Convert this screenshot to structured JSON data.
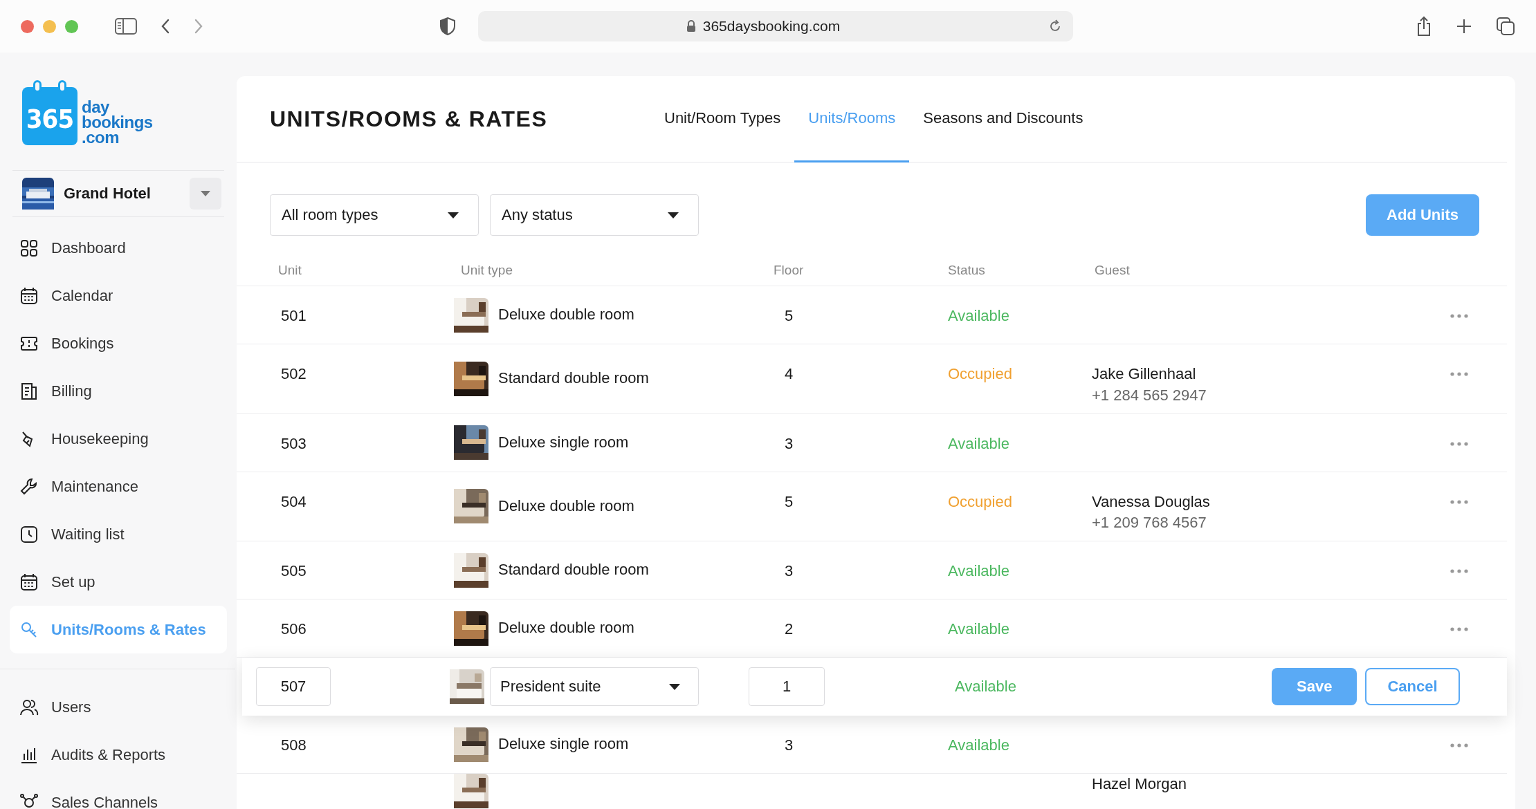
{
  "browser": {
    "url": "365daysbooking.com"
  },
  "logo": {
    "number": "365",
    "lines": [
      "day",
      "bookings",
      ".com"
    ]
  },
  "property": {
    "name": "Grand Hotel"
  },
  "sidebar": {
    "items": [
      {
        "label": "Dashboard",
        "selected": false
      },
      {
        "label": "Calendar",
        "selected": false
      },
      {
        "label": "Bookings",
        "selected": false
      },
      {
        "label": "Billing",
        "selected": false
      },
      {
        "label": "Housekeeping",
        "selected": false
      },
      {
        "label": "Maintenance",
        "selected": false
      },
      {
        "label": "Waiting list",
        "selected": false
      },
      {
        "label": "Set up",
        "selected": false
      },
      {
        "label": "Units/Rooms & Rates",
        "selected": true
      }
    ],
    "bottom_items": [
      {
        "label": "Users",
        "selected": false
      },
      {
        "label": "Audits & Reports",
        "selected": false
      },
      {
        "label": "Sales Channels",
        "selected": false
      }
    ]
  },
  "page": {
    "title": "UNITS/ROOMS & RATES",
    "tabs": [
      {
        "label": "Unit/Room Types",
        "selected": false
      },
      {
        "label": "Units/Rooms",
        "selected": true
      },
      {
        "label": "Seasons and Discounts",
        "selected": false
      }
    ],
    "filters": [
      {
        "value": "All room types"
      },
      {
        "value": "Any status"
      }
    ],
    "add_button": "Add Units"
  },
  "table": {
    "columns": [
      "Unit",
      "Unit type",
      "Floor",
      "Status",
      "Guest"
    ],
    "rows": [
      {
        "kind": "view",
        "unit": "501",
        "type": "Deluxe double room",
        "floor": "5",
        "status": "Available",
        "color": "#4cb860"
      },
      {
        "kind": "view",
        "unit": "502",
        "type": "Standard double room",
        "floor": "4",
        "status": "Occupied",
        "color": "#f0a030",
        "guest": "Jake Gillenhaal",
        "phone": "+1 284 565 2947"
      },
      {
        "kind": "view",
        "unit": "503",
        "type": "Deluxe single room",
        "floor": "3",
        "status": "Available",
        "color": "#4cb860"
      },
      {
        "kind": "view",
        "unit": "504",
        "type": "Deluxe double room",
        "floor": "5",
        "status": "Occupied",
        "color": "#f0a030",
        "guest": "Vanessa Douglas",
        "phone": "+1 209 768 4567"
      },
      {
        "kind": "view",
        "unit": "505",
        "type": "Standard double room",
        "floor": "3",
        "status": "Available",
        "color": "#4cb860"
      },
      {
        "kind": "view",
        "unit": "506",
        "type": "Deluxe double room",
        "floor": "2",
        "status": "Available",
        "color": "#4cb860"
      },
      {
        "kind": "edit",
        "unit": "507",
        "type": "President suite",
        "floor": "1",
        "status": "Available",
        "color": "#4cb860",
        "save": "Save",
        "cancel": "Cancel"
      },
      {
        "kind": "view",
        "unit": "508",
        "type": "Deluxe single room",
        "floor": "3",
        "status": "Available",
        "color": "#4cb860"
      },
      {
        "kind": "view",
        "guest": "Hazel Morgan"
      }
    ]
  }
}
